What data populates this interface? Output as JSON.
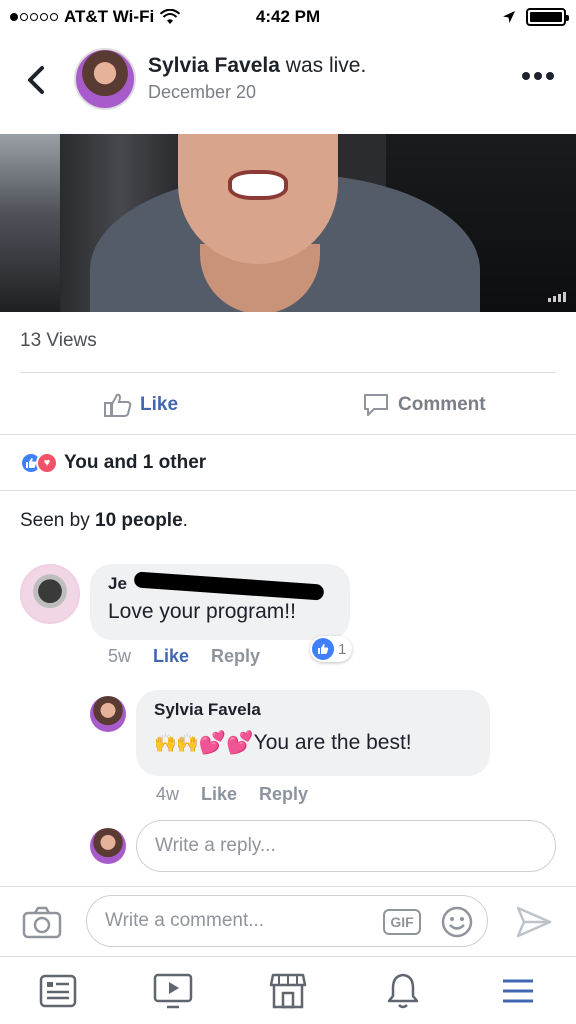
{
  "status_bar": {
    "carrier": "AT&T Wi-Fi",
    "time": "4:42 PM"
  },
  "post_header": {
    "author": "Sylvia Favela",
    "action": " was live.",
    "date": "December 20"
  },
  "post": {
    "views": "13 Views",
    "like_label": "Like",
    "comment_label": "Comment",
    "reactions_text": "You and 1 other",
    "seen_prefix": "Seen by ",
    "seen_count": "10 people",
    "seen_suffix": "."
  },
  "comments": [
    {
      "author_visible": "Je",
      "text": "Love your program!!",
      "time": "5w",
      "like_label": "Like",
      "reply_label": "Reply",
      "like_count": "1"
    },
    {
      "author": "Sylvia Favela",
      "text": "You are the best!",
      "time": "4w",
      "like_label": "Like",
      "reply_label": "Reply"
    }
  ],
  "reply_input": {
    "placeholder": "Write a reply..."
  },
  "composer": {
    "placeholder": "Write a comment...",
    "gif_label": "GIF"
  },
  "tabs": [
    "news-feed",
    "watch",
    "marketplace",
    "notifications",
    "menu"
  ],
  "colors": {
    "accent": "#4267b2",
    "reaction_like": "#4080ff",
    "reaction_love": "#f25268",
    "muted": "#8d949e"
  }
}
